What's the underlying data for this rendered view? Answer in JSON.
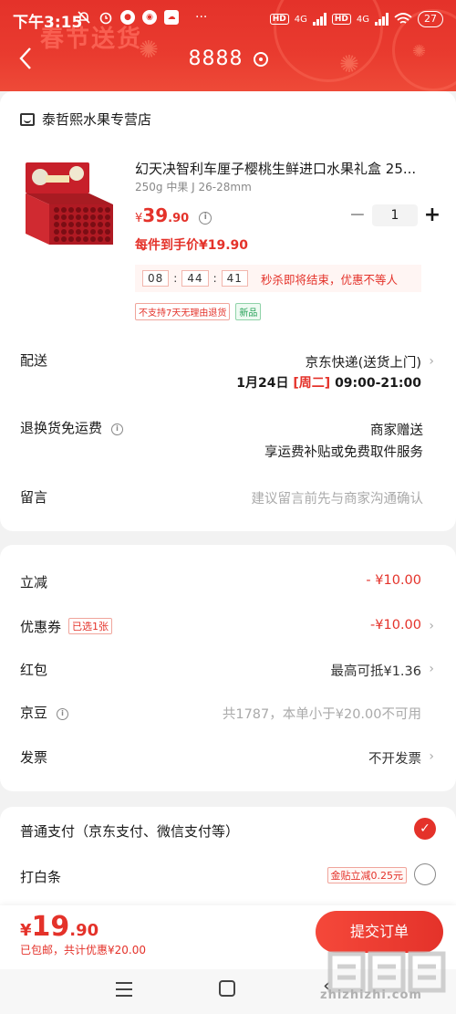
{
  "status_bar": {
    "time": "下午3:15",
    "battery": "27",
    "network_1": "4G",
    "network_2": "4G",
    "hd_1": "HD",
    "hd_2": "HD"
  },
  "header": {
    "title": "8888",
    "banner_text": "春节送货"
  },
  "store": {
    "name": "泰哲熙水果专营店"
  },
  "product": {
    "name": "幻天决智利车厘子樱桃生鲜进口水果礼盒 25...",
    "spec": "250g 中果 J 26-28mm",
    "price_symbol": "¥",
    "price_int": "39",
    "price_dec": ".90",
    "quantity": "1",
    "unit_price": "每件到手价¥19.90",
    "countdown": {
      "h": "08",
      "m": "44",
      "s": "41",
      "text": "秒杀即将结束，优惠不等人"
    },
    "tags": [
      "不支持7天无理由退货",
      "新品"
    ]
  },
  "delivery": {
    "label": "配送",
    "method": "京东快递(送货上门)",
    "date": "1月24日",
    "weekday": "[周二]",
    "time": "09:00-21:00"
  },
  "return_shipping": {
    "label": "退换货免运费",
    "line1": "商家赠送",
    "line2": "享运费补贴或免费取件服务"
  },
  "message": {
    "label": "留言",
    "placeholder": "建议留言前先与商家沟通确认"
  },
  "discounts": {
    "lijian": {
      "label": "立减",
      "value": "- ¥10.00"
    },
    "coupon": {
      "label": "优惠券",
      "tag": "已选1张",
      "value": "-¥10.00"
    },
    "hongbao": {
      "label": "红包",
      "value": "最高可抵¥1.36"
    },
    "jingdou": {
      "label": "京豆",
      "value": "共1787，本单小于¥20.00不可用"
    },
    "invoice": {
      "label": "发票",
      "value": "不开发票"
    }
  },
  "payment": {
    "normal": {
      "label": "普通支付（京东支付、微信支付等）",
      "selected": true
    },
    "baitiao": {
      "label": "打白条",
      "tag": "金贴立减0.25元",
      "selected": false
    }
  },
  "footer": {
    "total_symbol": "¥",
    "total_int": "19",
    "total_dec": ".90",
    "sub": "已包邮，共计优惠¥20.00",
    "submit": "提交订单"
  },
  "watermark": {
    "text": "zhizhizhi.com",
    "logo_text": "值"
  },
  "colors": {
    "brand_red": "#e4322a",
    "check_green": "#2aa35a"
  }
}
